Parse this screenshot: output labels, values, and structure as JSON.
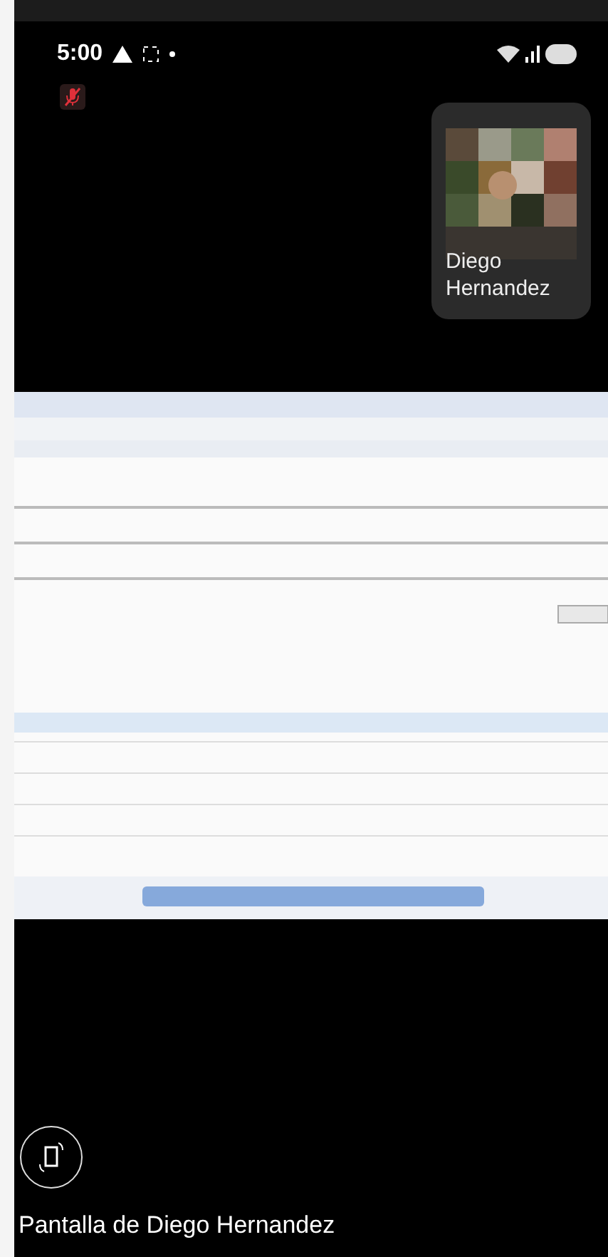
{
  "status_bar": {
    "time": "5:00"
  },
  "self": {
    "muted": true
  },
  "participant": {
    "name": "Diego Hernandez"
  },
  "caption": "Pantalla de Diego Hernandez"
}
